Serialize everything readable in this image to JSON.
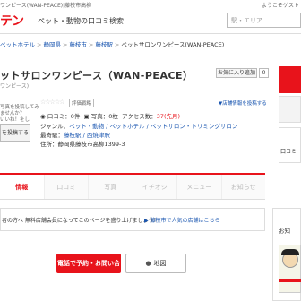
{
  "topbar": {
    "left_text": "ワンピース(WAN-PEACE)|藤枝市高柳",
    "right_text": "ようこそゲスト"
  },
  "header": {
    "logo": "テン",
    "tagline": "ペット・動物の口コミ検索",
    "search_placeholder": "駅・エリア"
  },
  "breadcrumb": [
    {
      "label": "ペットホテル"
    },
    {
      "label": "静岡県"
    },
    {
      "label": "藤枝市"
    },
    {
      "label": "藤枝駅"
    },
    {
      "label": "ペットサロンワンピース(WAN-PEACE)"
    }
  ],
  "shop": {
    "title": "ットサロンワンピース（WAN-PEACE）",
    "title_sub": "（ペ",
    "kana": "ワンピース)",
    "favorite_label": "お気に入り追加",
    "favorite_count": "0",
    "note": "写真を投稿してみ\nませんか？\nいいね！をし",
    "post_button": "を投稿する",
    "stars": "☆☆☆☆☆",
    "eval_badge": "評価戦略",
    "report_link": "▼店舗情報を投稿する",
    "stats": {
      "reviews": "口コミ：0件",
      "photos": "写真：0枚",
      "access_label": "アクセス数：",
      "access_value": "37(先月)"
    },
    "genre_label": "ジャンル：",
    "genre": "ペット・動物 / ペットホテル / ペットサロン・トリミングサロン",
    "station_label": "最寄駅：",
    "station": "藤枝駅 / 西焼津駅",
    "address": "住所：静岡県藤枝市高柳1399-3",
    "camera_label": "口コミ"
  },
  "tabs": [
    {
      "label": "情報"
    },
    {
      "label": "口コミ"
    },
    {
      "label": "写真"
    },
    {
      "label": "イチオシ"
    },
    {
      "label": "メニュー"
    },
    {
      "label": "お知らせ"
    }
  ],
  "notice": {
    "text": "者の方へ 無料店舗会員になってこのページを盛り上げましょう！",
    "link": "▶ 藤枝市で人気の店舗はこちら"
  },
  "cta": {
    "call": "電話で予約・お問い合わせ",
    "map": "地図"
  },
  "right_panel": {
    "title": "お知"
  }
}
